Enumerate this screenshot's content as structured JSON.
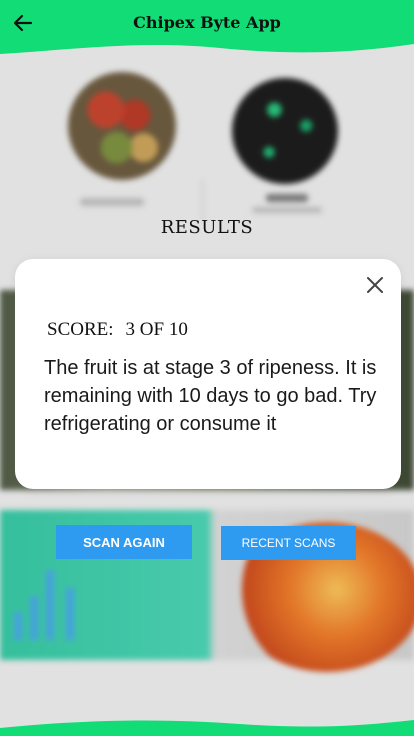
{
  "header": {
    "title": "Chipex Byte App",
    "back_icon": "arrow-left-icon",
    "color": "#11dc75"
  },
  "results_heading": "RESULTS",
  "modal": {
    "close_icon": "close-icon",
    "score_label": "SCORE:",
    "score_value": "3 OF 10",
    "message": "The  fruit is at stage  3 of ripeness. It is remaining  with 10 days to go bad. Try refrigerating or consume it"
  },
  "buttons": {
    "scan_again": "SCAN AGAIN",
    "recent_scans": "RECENT SCANS",
    "color": "#2f9bf0"
  }
}
